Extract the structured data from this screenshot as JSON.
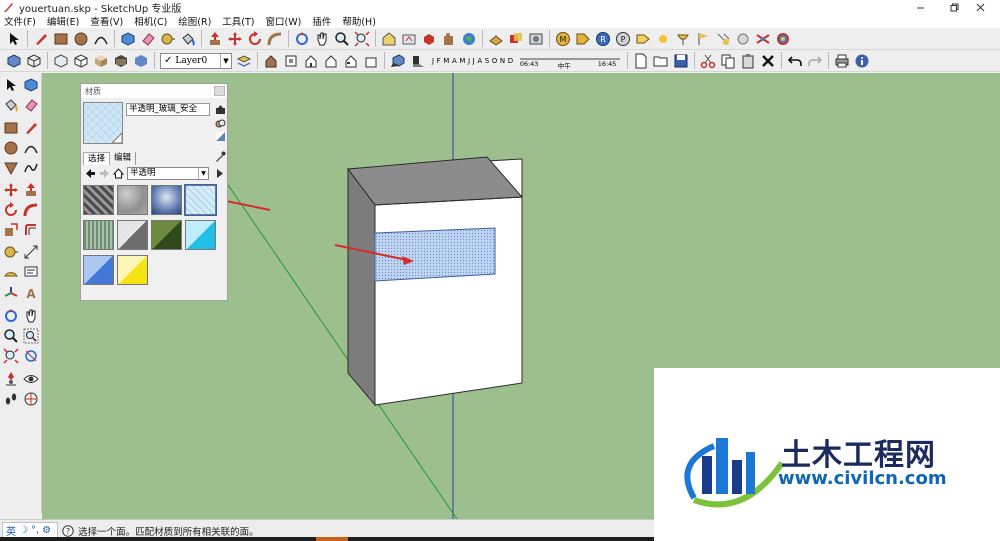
{
  "window": {
    "title": "youertuan.skp - SketchUp 专业版"
  },
  "menu": {
    "items": [
      "文件(F)",
      "编辑(E)",
      "查看(V)",
      "相机(C)",
      "绘图(R)",
      "工具(T)",
      "窗口(W)",
      "插件",
      "帮助(H)"
    ]
  },
  "toolbar": {
    "layer_checked": "✓",
    "layer_name": "Layer0",
    "months": [
      "J",
      "F",
      "M",
      "A",
      "M",
      "J",
      "J",
      "A",
      "S",
      "O",
      "N",
      "D"
    ],
    "time_start": "06:43",
    "time_mid": "中午",
    "time_end": "16:45"
  },
  "materials_panel": {
    "title": "材质",
    "material_name": "半透明_玻璃_安全",
    "tabs": [
      "选择",
      "编辑"
    ],
    "library": "半透明",
    "swatches": [
      {
        "name": "dark-stone"
      },
      {
        "name": "gray-speckle"
      },
      {
        "name": "blue-sky-glass"
      },
      {
        "name": "safety-glass",
        "selected": true
      },
      {
        "name": "green-striped"
      },
      {
        "name": "gray-triangle"
      },
      {
        "name": "green-triangle"
      },
      {
        "name": "cyan-triangle"
      },
      {
        "name": "blue-triangle"
      },
      {
        "name": "yellow-triangle"
      }
    ]
  },
  "status": {
    "ime_lang": "英",
    "text": "选择一个面。匹配材质到所有相关联的面。"
  },
  "watermark": {
    "brand": "土木工程网",
    "url": "www.civilcn.com"
  },
  "colors": {
    "viewport": "#9cbf8d",
    "axis_blue": "#2f3fa8",
    "axis_green": "#1f9a37",
    "arrow_red": "#d92b2b",
    "glass": "#bcd3f2"
  }
}
